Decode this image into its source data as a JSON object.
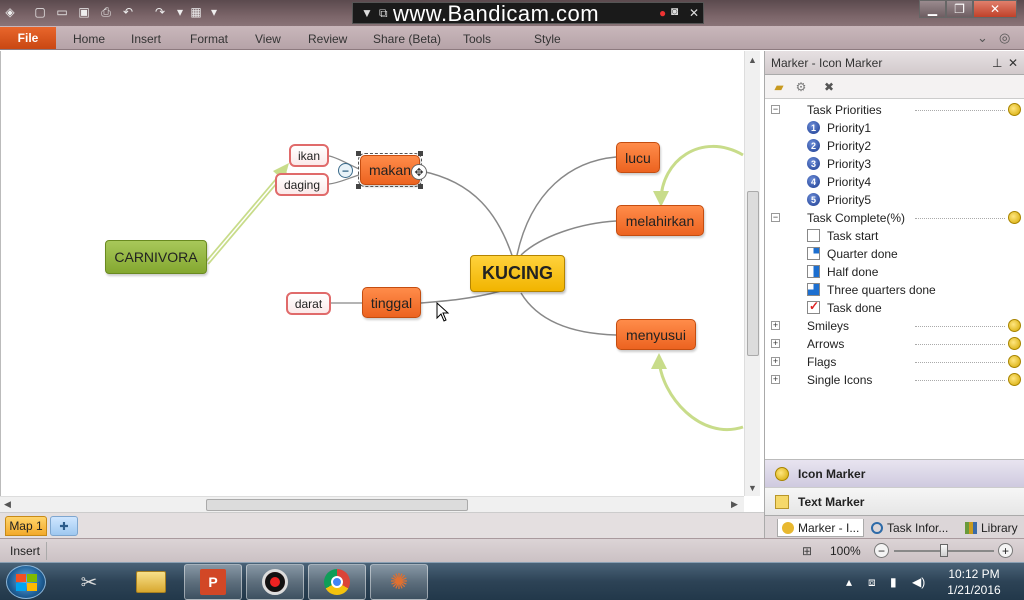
{
  "window": {
    "watermark": "www.Bandicam.com"
  },
  "ribbon": {
    "file_label": "File",
    "tabs": [
      "Home",
      "Insert",
      "Format",
      "View",
      "Review",
      "Share (Beta)",
      "Tools",
      "Style"
    ]
  },
  "mindmap": {
    "central": "KUCING",
    "main_topics": [
      "makan",
      "tinggal",
      "lucu",
      "melahirkan",
      "menyusui"
    ],
    "subtopics": [
      "ikan",
      "daging",
      "darat"
    ],
    "floating": "CARNIVORA",
    "collapse_symbol": "−"
  },
  "map_tabs": {
    "active": "Map 1"
  },
  "panel": {
    "title": "Marker - Icon Marker",
    "tree": [
      {
        "label": "Task Priorities",
        "expanded": true,
        "kind": "group"
      },
      {
        "label": "Priority1",
        "kind": "priority",
        "num": "1"
      },
      {
        "label": "Priority2",
        "kind": "priority",
        "num": "2"
      },
      {
        "label": "Priority3",
        "kind": "priority",
        "num": "3"
      },
      {
        "label": "Priority4",
        "kind": "priority",
        "num": "4"
      },
      {
        "label": "Priority5",
        "kind": "priority",
        "num": "5"
      },
      {
        "label": "Task Complete(%)",
        "expanded": true,
        "kind": "group"
      },
      {
        "label": "Task start",
        "kind": "progress",
        "fill": 0
      },
      {
        "label": "Quarter done",
        "kind": "progress",
        "fill": 0.25
      },
      {
        "label": "Half done",
        "kind": "progress",
        "fill": 0.5
      },
      {
        "label": "Three quarters done",
        "kind": "progress",
        "fill": 0.75
      },
      {
        "label": "Task done",
        "kind": "progress",
        "fill": 1
      },
      {
        "label": "Smileys",
        "expanded": false,
        "kind": "group"
      },
      {
        "label": "Arrows",
        "expanded": false,
        "kind": "group"
      },
      {
        "label": "Flags",
        "expanded": false,
        "kind": "group"
      },
      {
        "label": "Single Icons",
        "expanded": false,
        "kind": "group"
      }
    ],
    "sections": [
      "Icon Marker",
      "Text Marker"
    ],
    "bottom_tabs": [
      "Marker - I...",
      "Task Infor...",
      "Library"
    ]
  },
  "status": {
    "mode": "Insert",
    "zoom": "100%",
    "zoom_out": "−",
    "zoom_in": "+"
  },
  "taskbar": {
    "time": "10:12 PM",
    "date": "1/21/2016"
  },
  "colors": {
    "central": "#f1b400",
    "main_topic": "#ec6320",
    "subtopic_border": "#e06a6a",
    "floating": "#84a830",
    "relationship": "#c8dc8a",
    "connector": "#888888",
    "file_tab": "#c94712"
  }
}
